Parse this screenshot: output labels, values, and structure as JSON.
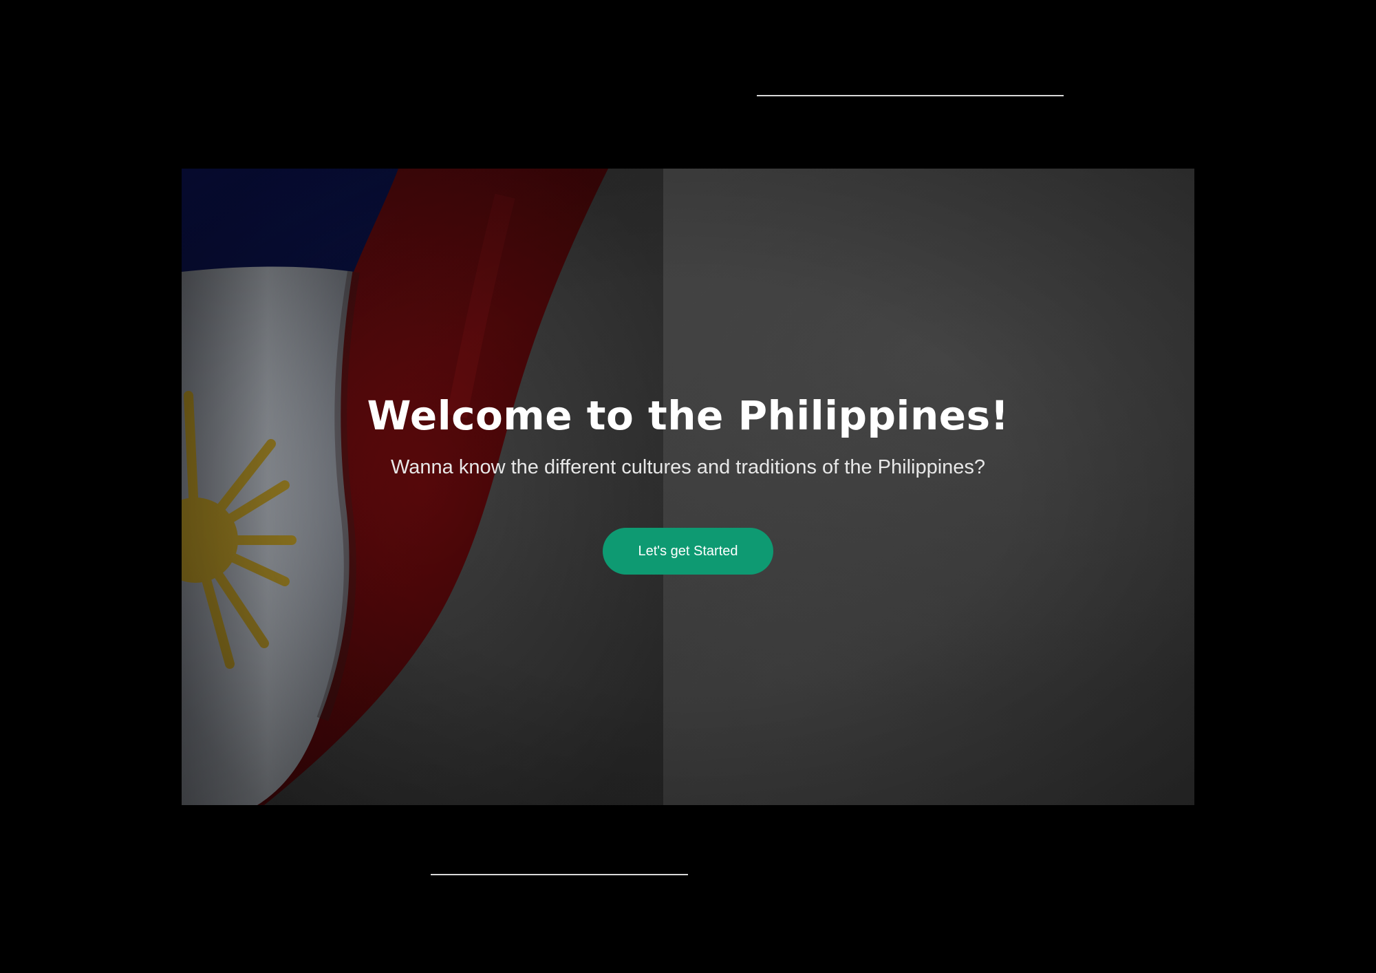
{
  "hero": {
    "title": "Welcome to the Philippines!",
    "subtitle": "Wanna know the different cultures and traditions of the Philippines?",
    "cta_label": "Let's get Started",
    "background_image": "philippine-flag-on-dark-stone",
    "colors": {
      "cta": "#0e9a72",
      "flag_blue": "#0a1670",
      "flag_red": "#7a0a0e",
      "flag_white": "#9aa0a8",
      "flag_sun": "#b08a10",
      "backdrop": "#3a3a3a"
    }
  }
}
